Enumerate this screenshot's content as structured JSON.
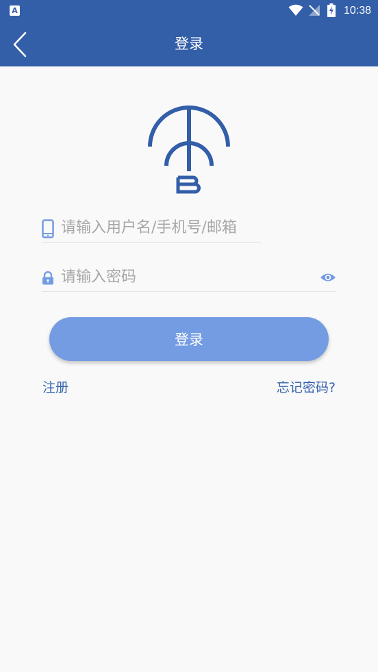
{
  "status_bar": {
    "app_icon_label": "A",
    "time": "10:38"
  },
  "header": {
    "title": "登录",
    "back_icon": "chevron-left-icon"
  },
  "colors": {
    "brand": "#335ea8",
    "button": "#739ce2",
    "link": "#3361a9",
    "background": "#f9f9fa"
  },
  "form": {
    "account": {
      "placeholder": "请输入用户名/手机号/邮箱",
      "value": "",
      "icon": "phone-icon"
    },
    "password": {
      "placeholder": "请输入密码",
      "value": "",
      "icon": "lock-icon",
      "toggle_icon": "eye-icon"
    },
    "submit_label": "登录"
  },
  "links": {
    "register": "注册",
    "forgot": "忘记密码?"
  }
}
